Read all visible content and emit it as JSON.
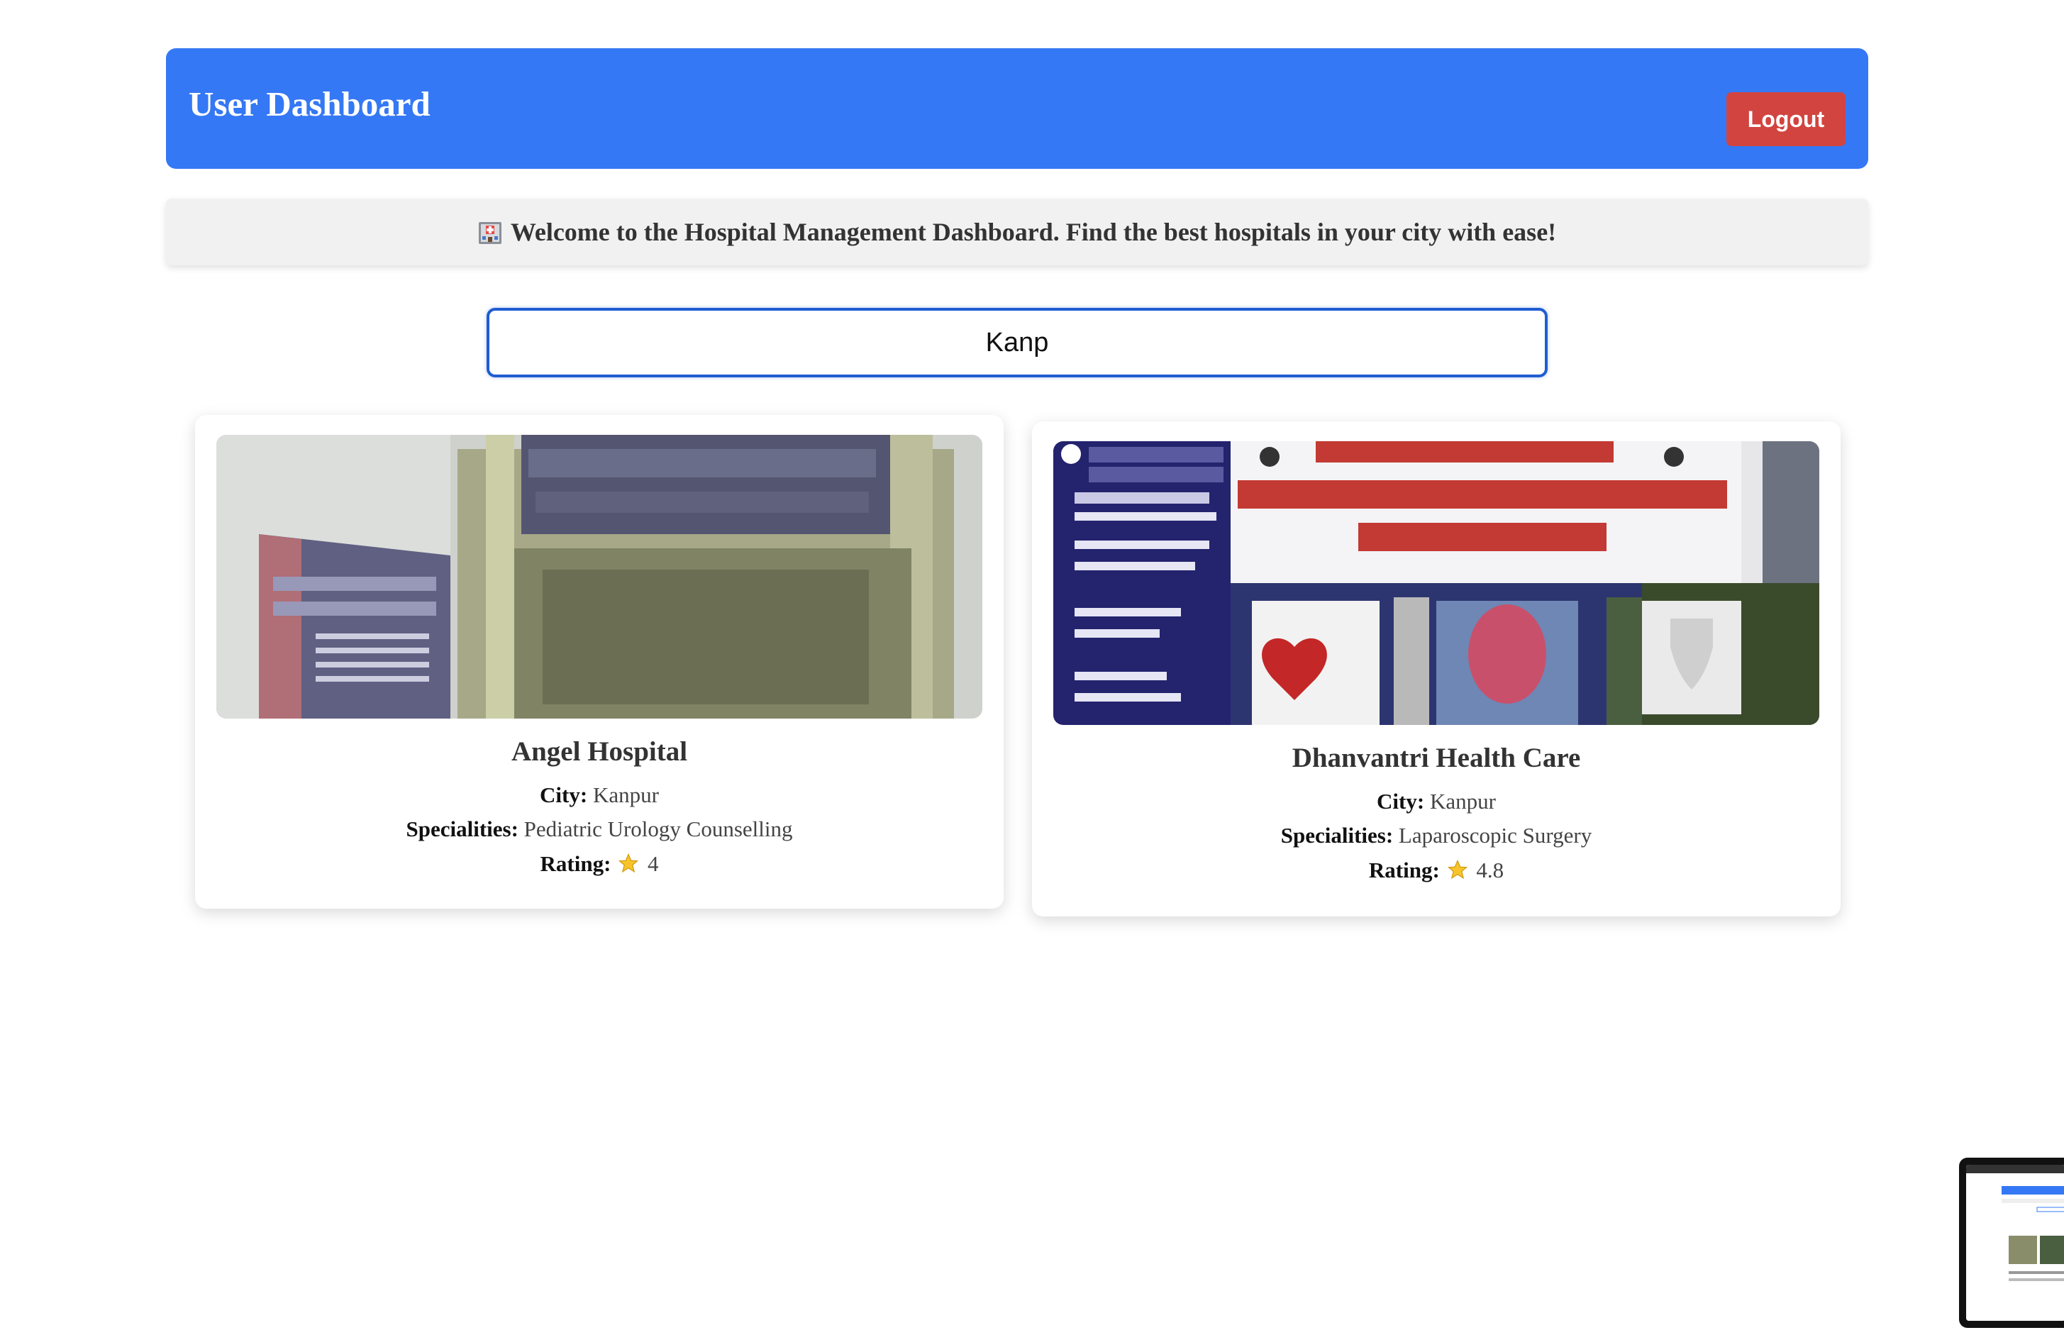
{
  "header": {
    "title": "User Dashboard",
    "logout_label": "Logout",
    "color": "#3578f5",
    "logout_color": "#d2443f"
  },
  "welcome": {
    "icon": "hospital-icon",
    "text": "Welcome to the Hospital Management Dashboard. Find the best hospitals in your city with ease!"
  },
  "search": {
    "value": "Kanp",
    "placeholder": ""
  },
  "hospitals": [
    {
      "name": "Angel Hospital",
      "city_label": "City:",
      "city": "Kanpur",
      "specialities_label": "Specialities:",
      "specialities": "Pediatric Urology Counselling",
      "rating_label": "Rating:",
      "rating_icon": "star-icon",
      "rating": "4"
    },
    {
      "name": "Dhanvantri Health Care",
      "city_label": "City:",
      "city": "Kanpur",
      "specialities_label": "Specialities:",
      "specialities": "Laparoscopic Surgery",
      "rating_label": "Rating:",
      "rating_icon": "star-icon",
      "rating": "4.8"
    }
  ]
}
